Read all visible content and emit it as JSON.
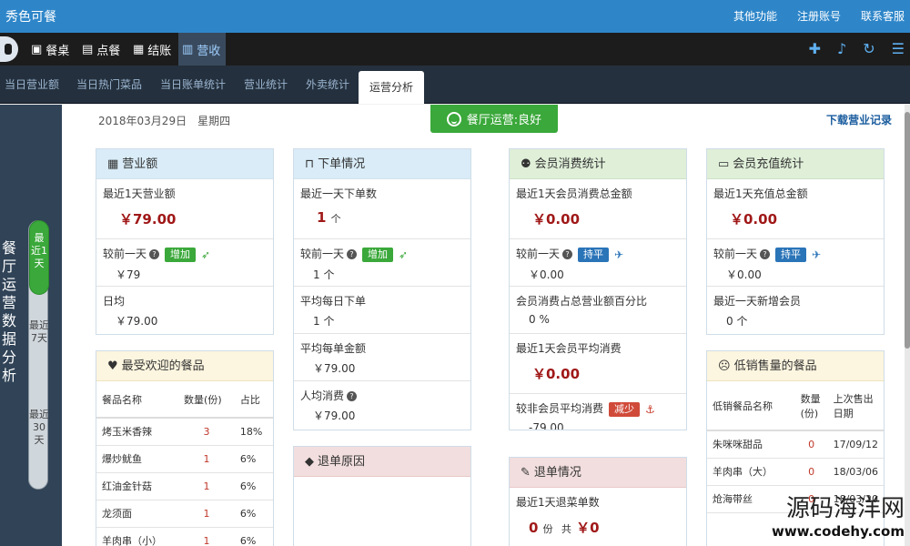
{
  "app": {
    "title": "秀色可餐"
  },
  "top_links": [
    "其他功能",
    "注册账号",
    "联系客服"
  ],
  "nav": {
    "items": [
      {
        "icon": "table-icon",
        "label": "餐桌"
      },
      {
        "icon": "book-icon",
        "label": "点餐"
      },
      {
        "icon": "calculator-icon",
        "label": "结账"
      },
      {
        "icon": "bar-chart-icon",
        "label": "营收"
      }
    ],
    "active": "营收",
    "right_icons": [
      "gift-icon",
      "bell-icon",
      "refresh-icon",
      "menu-icon"
    ]
  },
  "tabs": [
    "当日营业额",
    "当日热门菜品",
    "当日账单统计",
    "营业统计",
    "外卖统计",
    "运营分析"
  ],
  "active_tab": "运营分析",
  "side": {
    "title": "餐厅运营数据分析",
    "ranges": [
      "最近1天",
      "最近7天",
      "最近30天"
    ],
    "active_range": "最近1天"
  },
  "header": {
    "date": "2018年03月29日　星期四",
    "status": "餐厅运营:良好",
    "download": "下载营业记录"
  },
  "revenue": {
    "title": "营业额",
    "recent_label": "最近1天营业额",
    "recent_value": "￥79.00",
    "compare_label": "较前一天",
    "compare_badge": "增加",
    "compare_value": "￥79",
    "daily_label": "日均",
    "daily_value": "￥79.00"
  },
  "orders": {
    "title": "下单情况",
    "recent_label": "最近一天下单数",
    "recent_value": "1",
    "recent_unit": "个",
    "compare_label": "较前一天",
    "compare_badge": "增加",
    "compare_value": "1 个",
    "avg_orders_label": "平均每日下单",
    "avg_orders_value": "1 个",
    "avg_amount_label": "平均每单金额",
    "avg_amount_value": "￥79.00",
    "per_person_label": "人均消费",
    "per_person_value": "￥79.00"
  },
  "member_consume": {
    "title": "会员消费统计",
    "recent_label": "最近1天会员消费总金额",
    "recent_value": "￥0.00",
    "compare_label": "较前一天",
    "compare_badge": "持平",
    "compare_value": "￥0.00",
    "percent_label": "会员消费占总营业额百分比",
    "percent_value": "0 %",
    "avg_label": "最近1天会员平均消费",
    "avg_value": "￥0.00",
    "nonmember_label": "较非会员平均消费",
    "nonmember_badge": "减少",
    "nonmember_value": "-79.00"
  },
  "member_recharge": {
    "title": "会员充值统计",
    "recent_label": "最近1天充值总金额",
    "recent_value": "￥0.00",
    "compare_label": "较前一天",
    "compare_badge": "持平",
    "compare_value": "￥0.00",
    "new_label": "最近一天新增会员",
    "new_value": "0 个"
  },
  "popular": {
    "title": "最受欢迎的餐品",
    "columns": [
      "餐品名称",
      "数量(份)",
      "占比"
    ],
    "rows": [
      {
        "name": "烤玉米香辣",
        "qty": "3",
        "pct": "18%"
      },
      {
        "name": "爆炒鱿鱼",
        "qty": "1",
        "pct": "6%"
      },
      {
        "name": "红油金针菇",
        "qty": "1",
        "pct": "6%"
      },
      {
        "name": "龙须面",
        "qty": "1",
        "pct": "6%"
      },
      {
        "name": "羊肉串（小）",
        "qty": "1",
        "pct": "6%"
      }
    ]
  },
  "refund_reason": {
    "title": "退单原因"
  },
  "refunds": {
    "title": "退单情况",
    "label": "最近1天退菜单数",
    "count": "0",
    "count_unit": "份",
    "total_label": "共",
    "total_value": "￥0"
  },
  "low_sales": {
    "title": "低销售量的餐品",
    "columns": [
      "低销餐品名称",
      "数量(份)",
      "上次售出日期"
    ],
    "rows": [
      {
        "name": "朱咪咪甜品",
        "qty": "0",
        "date": "17/09/12"
      },
      {
        "name": "羊肉串（大）",
        "qty": "0",
        "date": "18/03/06"
      },
      {
        "name": "炝海带丝",
        "qty": "0",
        "date": "18/03/20"
      }
    ]
  },
  "watermark": {
    "line1": "源码海洋网",
    "line2": "www.codehy.com"
  }
}
